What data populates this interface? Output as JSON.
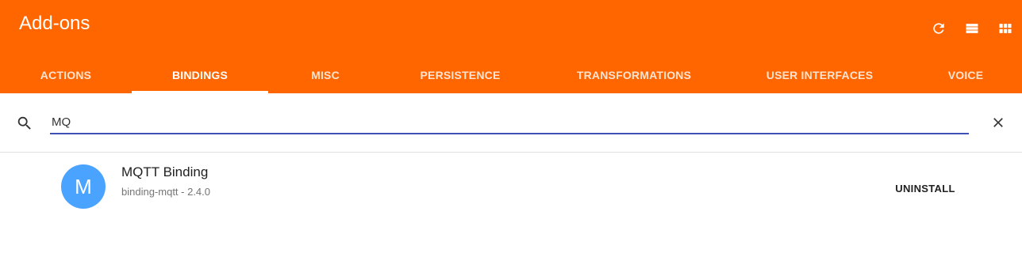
{
  "header": {
    "title": "Add-ons",
    "background_color": "#ff6600",
    "actions": [
      {
        "name": "refresh-icon"
      },
      {
        "name": "list-view-icon"
      },
      {
        "name": "grid-view-icon"
      }
    ]
  },
  "tabs": [
    {
      "label": "ACTIONS"
    },
    {
      "label": "BINDINGS",
      "active": true
    },
    {
      "label": "MISC"
    },
    {
      "label": "PERSISTENCE"
    },
    {
      "label": "TRANSFORMATIONS"
    },
    {
      "label": "USER INTERFACES"
    },
    {
      "label": "VOICE"
    }
  ],
  "search": {
    "value": "MQ",
    "icon": "search-icon",
    "clear_icon": "close-icon",
    "underline_color": "#3f51b5"
  },
  "results": [
    {
      "avatar_letter": "M",
      "avatar_color": "#4aa3ff",
      "title": "MQTT Binding",
      "subtitle": "binding-mqtt - 2.4.0",
      "action_label": "UNINSTALL"
    }
  ]
}
